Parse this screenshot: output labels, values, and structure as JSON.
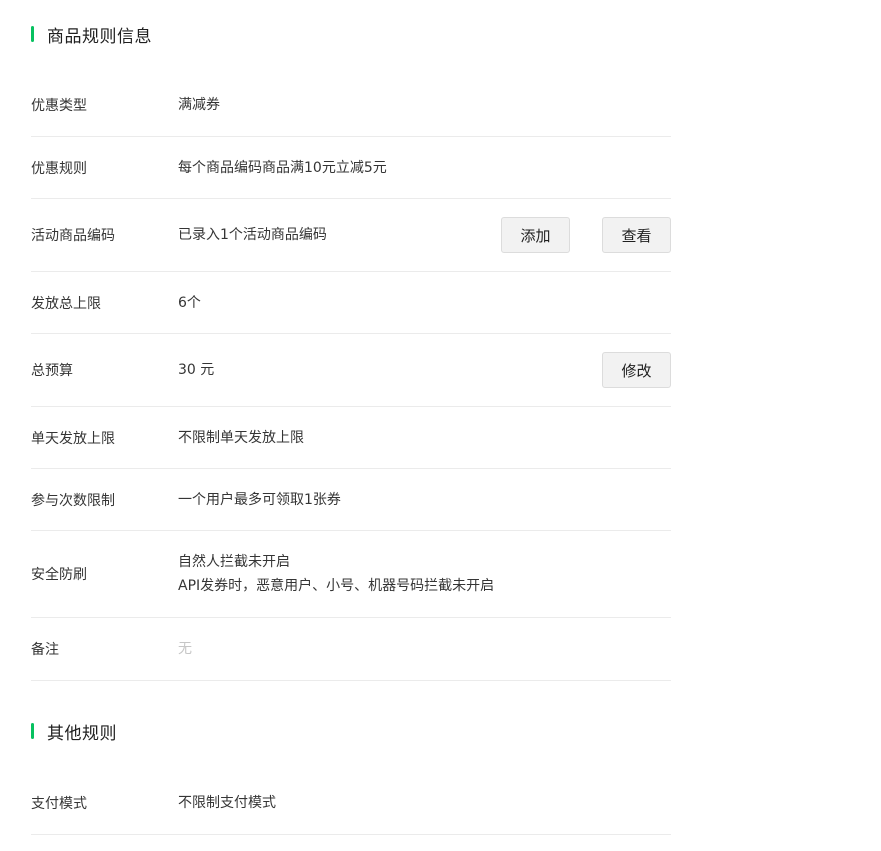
{
  "section_rules": {
    "title": "商品规则信息",
    "rows": [
      {
        "label": "优惠类型",
        "value": "满减券"
      },
      {
        "label": "优惠规则",
        "value": "每个商品编码商品满10元立减5元"
      },
      {
        "label": "活动商品编码",
        "value": "已录入1个活动商品编码",
        "buttons": [
          "添加",
          "查看"
        ]
      },
      {
        "label": "发放总上限",
        "value": "6个"
      },
      {
        "label": "总预算",
        "value": "30 元",
        "buttons": [
          "修改"
        ]
      },
      {
        "label": "单天发放上限",
        "value": "不限制单天发放上限"
      },
      {
        "label": "参与次数限制",
        "value": "一个用户最多可领取1张券"
      },
      {
        "label": "安全防刷",
        "value_line1": "自然人拦截未开启",
        "value_line2": "API发券时，恶意用户、小号、机器号码拦截未开启"
      },
      {
        "label": "备注",
        "value": "无"
      }
    ]
  },
  "section_other": {
    "title": "其他规则",
    "rows": [
      {
        "label": "支付模式",
        "value": "不限制支付模式"
      }
    ]
  },
  "colors": {
    "accent": "#07c160",
    "text": "#353535",
    "muted": "#c6c6c6",
    "divider": "#ebebeb",
    "button_bg": "#f2f2f2"
  }
}
